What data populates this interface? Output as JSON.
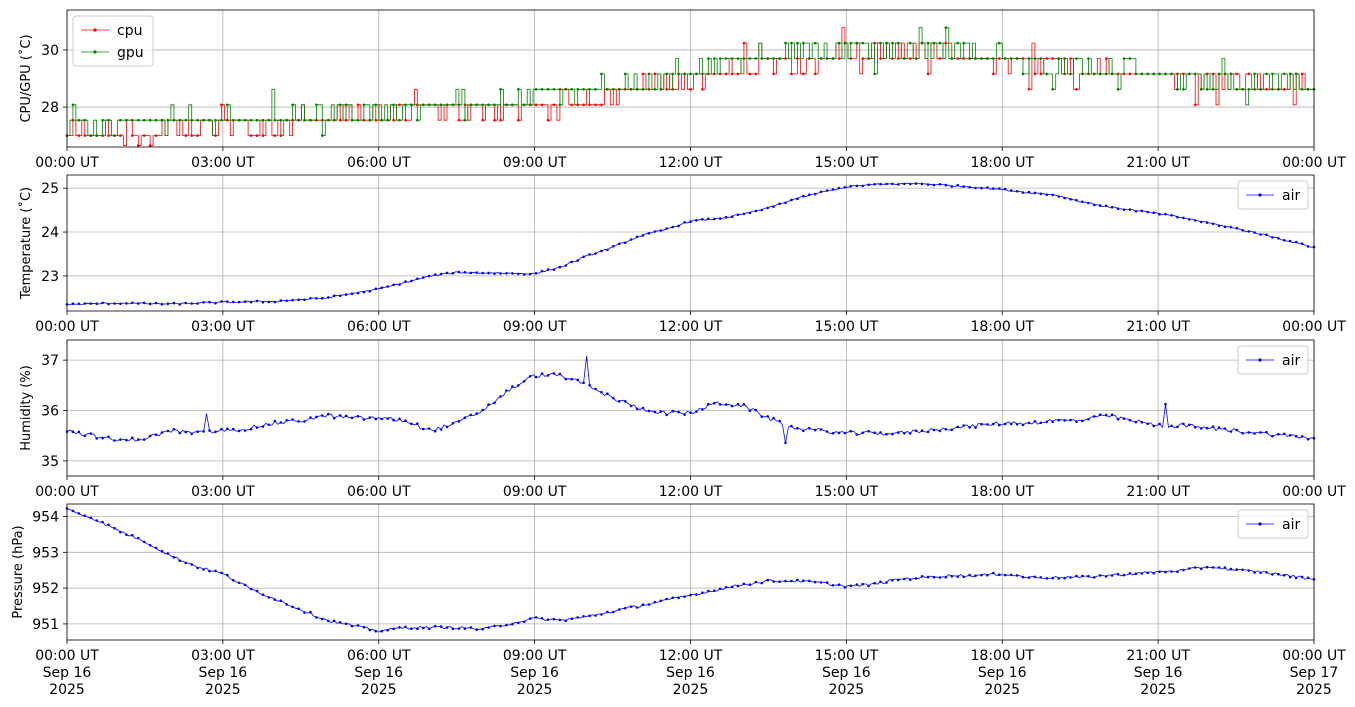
{
  "chart_data": [
    {
      "type": "line",
      "ylabel": "CPU/GPU (˚C)",
      "ylim": [
        26.6,
        31.4
      ],
      "yticks": [
        28,
        30
      ],
      "xticks": [
        "00:00 UT",
        "03:00 UT",
        "06:00 UT",
        "09:00 UT",
        "12:00 UT",
        "15:00 UT",
        "18:00 UT",
        "21:00 UT",
        "00:00 UT"
      ],
      "xlim_hours": [
        0,
        24
      ],
      "grid": true,
      "legend": "top-left",
      "series": [
        {
          "name": "cpu",
          "color": "#ff0000",
          "x": [
            0,
            1,
            2,
            3,
            4,
            5,
            6,
            6.5,
            7,
            7.5,
            8,
            8.5,
            9,
            9.5,
            10,
            10.5,
            11,
            11.5,
            12,
            12.5,
            13,
            13.5,
            14,
            14.5,
            15,
            15.5,
            16,
            16.5,
            17,
            17.5,
            18,
            18.5,
            19,
            19.5,
            20,
            20.5,
            21,
            21.5,
            22,
            22.5,
            23,
            23.5,
            24
          ],
          "values": [
            27.1,
            27.2,
            27.2,
            27.3,
            27.4,
            27.6,
            27.8,
            27.9,
            27.9,
            27.9,
            27.9,
            28.0,
            28.0,
            28.1,
            28.2,
            28.4,
            28.6,
            28.8,
            29.0,
            29.2,
            29.3,
            29.5,
            29.6,
            29.7,
            29.8,
            29.8,
            29.9,
            29.9,
            29.8,
            29.7,
            29.6,
            29.5,
            29.5,
            29.4,
            29.3,
            29.2,
            29.1,
            29.0,
            29.0,
            28.9,
            28.8,
            28.7,
            28.6
          ]
        },
        {
          "name": "gpu",
          "color": "#008000",
          "x": [
            0,
            1,
            2,
            3,
            4,
            5,
            6,
            6.5,
            7,
            7.5,
            8,
            8.5,
            9,
            9.5,
            10,
            10.5,
            11,
            11.5,
            12,
            12.5,
            13,
            13.5,
            14,
            14.5,
            15,
            15.5,
            16,
            16.5,
            17,
            17.5,
            18,
            18.5,
            19,
            19.5,
            20,
            20.5,
            21,
            21.5,
            22,
            22.5,
            23,
            23.5,
            24
          ],
          "values": [
            27.4,
            27.4,
            27.5,
            27.5,
            27.6,
            27.7,
            27.9,
            28.0,
            28.1,
            28.1,
            28.2,
            28.3,
            28.4,
            28.5,
            28.6,
            28.8,
            28.9,
            29.1,
            29.3,
            29.5,
            29.6,
            29.8,
            29.9,
            30.0,
            30.1,
            30.1,
            30.1,
            30.0,
            29.9,
            29.8,
            29.7,
            29.6,
            29.5,
            29.4,
            29.3,
            29.3,
            29.2,
            29.1,
            29.0,
            28.9,
            28.9,
            28.8,
            28.7
          ]
        }
      ]
    },
    {
      "type": "line",
      "ylabel": "Temperature (˚C)",
      "ylim": [
        22.2,
        25.3
      ],
      "yticks": [
        23,
        24,
        25
      ],
      "xticks": [
        "00:00 UT",
        "03:00 UT",
        "06:00 UT",
        "09:00 UT",
        "12:00 UT",
        "15:00 UT",
        "18:00 UT",
        "21:00 UT",
        "00:00 UT"
      ],
      "xlim_hours": [
        0,
        24
      ],
      "grid": true,
      "legend": "top-right",
      "series": [
        {
          "name": "air",
          "color": "#0000ff",
          "x": [
            0,
            1,
            2,
            3,
            4,
            5,
            6,
            6.5,
            7,
            7.5,
            8,
            8.5,
            9,
            9.5,
            10,
            10.5,
            11,
            11.5,
            12,
            12.5,
            13,
            13.5,
            14,
            14.5,
            15,
            15.5,
            16,
            16.5,
            17,
            17.5,
            18,
            18.5,
            19,
            19.5,
            20,
            20.5,
            21,
            21.5,
            22,
            22.5,
            23,
            23.5,
            24
          ],
          "values": [
            22.35,
            22.38,
            22.36,
            22.4,
            22.42,
            22.5,
            22.7,
            22.85,
            23.0,
            23.08,
            23.07,
            23.06,
            23.05,
            23.2,
            23.45,
            23.65,
            23.9,
            24.05,
            24.25,
            24.3,
            24.4,
            24.55,
            24.75,
            24.9,
            25.03,
            25.08,
            25.1,
            25.1,
            25.06,
            25.02,
            24.97,
            24.9,
            24.85,
            24.7,
            24.58,
            24.5,
            24.42,
            24.32,
            24.2,
            24.08,
            23.95,
            23.8,
            23.65
          ]
        }
      ]
    },
    {
      "type": "line",
      "ylabel": "Humidity (%)",
      "ylim": [
        34.7,
        37.4
      ],
      "yticks": [
        35,
        36,
        37
      ],
      "xticks": [
        "00:00 UT",
        "03:00 UT",
        "06:00 UT",
        "09:00 UT",
        "12:00 UT",
        "15:00 UT",
        "18:00 UT",
        "21:00 UT",
        "00:00 UT"
      ],
      "xlim_hours": [
        0,
        24
      ],
      "grid": true,
      "legend": "top-right",
      "series": [
        {
          "name": "air",
          "color": "#0000ff",
          "x": [
            0,
            0.5,
            1,
            1.5,
            2,
            2.5,
            3,
            3.5,
            4,
            4.5,
            5,
            5.5,
            6,
            6.5,
            7,
            7.5,
            8,
            8.5,
            9,
            9.5,
            10,
            10.5,
            11,
            11.5,
            12,
            12.5,
            13,
            13.5,
            14,
            14.5,
            15,
            15.5,
            16,
            16.5,
            17,
            17.5,
            18,
            18.5,
            19,
            19.5,
            20,
            20.5,
            21,
            21.5,
            22,
            22.5,
            23,
            23.5,
            24
          ],
          "values": [
            35.6,
            35.5,
            35.4,
            35.45,
            35.6,
            35.55,
            35.6,
            35.65,
            35.75,
            35.8,
            35.9,
            35.85,
            35.85,
            35.8,
            35.6,
            35.75,
            36.0,
            36.4,
            36.7,
            36.7,
            36.5,
            36.25,
            36.05,
            35.95,
            35.95,
            36.15,
            36.1,
            35.85,
            35.65,
            35.6,
            35.55,
            35.55,
            35.55,
            35.6,
            35.65,
            35.7,
            35.75,
            35.75,
            35.8,
            35.8,
            35.9,
            35.8,
            35.7,
            35.7,
            35.65,
            35.6,
            35.55,
            35.5,
            35.45
          ]
        }
      ]
    },
    {
      "type": "line",
      "ylabel": "Pressure (hPa)",
      "ylim": [
        950.55,
        954.35
      ],
      "yticks": [
        951,
        952,
        953,
        954
      ],
      "xticks": [
        "00:00 UT\nSep 16\n2025",
        "03:00 UT\nSep 16\n2025",
        "06:00 UT\nSep 16\n2025",
        "09:00 UT\nSep 16\n2025",
        "12:00 UT\nSep 16\n2025",
        "15:00 UT\nSep 16\n2025",
        "18:00 UT\nSep 16\n2025",
        "21:00 UT\nSep 16\n2025",
        "00:00 UT\nSep 17\n2025"
      ],
      "xlim_hours": [
        0,
        24
      ],
      "grid": true,
      "legend": "top-right",
      "series": [
        {
          "name": "air",
          "color": "#0000ff",
          "x": [
            0,
            0.5,
            1,
            1.5,
            2,
            2.5,
            3,
            3.5,
            4,
            4.5,
            5,
            5.5,
            6,
            6.5,
            7,
            7.5,
            8,
            8.5,
            9,
            9.5,
            10,
            10.5,
            11,
            11.5,
            12,
            12.5,
            13,
            13.5,
            14,
            14.5,
            15,
            15.5,
            16,
            16.5,
            17,
            17.5,
            18,
            18.5,
            19,
            19.5,
            20,
            20.5,
            21,
            21.5,
            22,
            22.5,
            23,
            23.5,
            24
          ],
          "values": [
            954.2,
            953.95,
            953.6,
            953.3,
            952.9,
            952.6,
            952.4,
            952.0,
            951.7,
            951.4,
            951.1,
            950.95,
            950.8,
            950.9,
            950.9,
            950.9,
            950.85,
            951.0,
            951.15,
            951.1,
            951.2,
            951.35,
            951.5,
            951.65,
            951.8,
            951.95,
            952.1,
            952.2,
            952.2,
            952.15,
            952.05,
            952.1,
            952.25,
            952.3,
            952.35,
            952.35,
            952.4,
            952.3,
            952.3,
            952.3,
            952.35,
            952.4,
            952.45,
            952.5,
            952.6,
            952.5,
            952.45,
            952.35,
            952.25
          ]
        }
      ]
    }
  ]
}
